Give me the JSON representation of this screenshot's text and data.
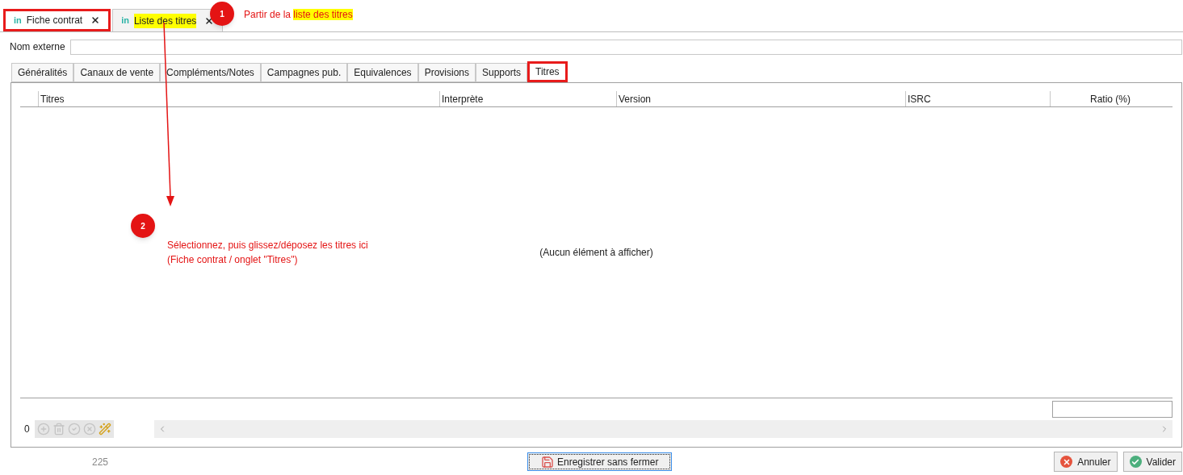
{
  "doc_tabs": [
    {
      "logo": "in",
      "label": "Fiche contrat",
      "selected": true,
      "outlined": true,
      "highlighted": false
    },
    {
      "logo": "in",
      "label": "Liste des titres",
      "selected": false,
      "outlined": false,
      "highlighted": true
    }
  ],
  "external_name": {
    "label": "Nom externe"
  },
  "tabs": [
    {
      "label": "Généralités",
      "selected": false,
      "outlined": false
    },
    {
      "label": "Canaux de vente",
      "selected": false,
      "outlined": false
    },
    {
      "label": "Compléments/Notes",
      "selected": false,
      "outlined": false
    },
    {
      "label": "Campagnes pub.",
      "selected": false,
      "outlined": false
    },
    {
      "label": "Equivalences",
      "selected": false,
      "outlined": false
    },
    {
      "label": "Provisions",
      "selected": false,
      "outlined": false
    },
    {
      "label": "Supports",
      "selected": false,
      "outlined": false
    },
    {
      "label": "Titres",
      "selected": true,
      "outlined": true
    }
  ],
  "grid": {
    "columns": [
      "Titres",
      "Interprète",
      "Version",
      "ISRC",
      "Ratio (%)"
    ],
    "empty_text": "(Aucun élément à afficher)",
    "row_count": "0",
    "toolbar": [
      {
        "kind": "add",
        "disabled": true
      },
      {
        "kind": "delete",
        "disabled": true
      },
      {
        "kind": "confirm",
        "disabled": true
      },
      {
        "kind": "cancel",
        "disabled": true
      },
      {
        "kind": "wand",
        "disabled": false
      }
    ]
  },
  "footer": {
    "counter": "225",
    "save_button": {
      "label": "Enregistrer sans fermer",
      "focused": true
    },
    "buttons": [
      {
        "kind": "cancel",
        "label": "Annuler"
      },
      {
        "kind": "ok",
        "label": "Valider"
      }
    ]
  },
  "annotations": [
    {
      "number": "1",
      "parts": [
        {
          "text": "Partir de la ",
          "highlighted": false
        },
        {
          "text": "liste des titres",
          "highlighted": true
        }
      ]
    },
    {
      "number": "2",
      "parts": [
        {
          "text": "Sélectionnez, puis glissez/déposez les titres ici (Fiche contrat / onglet \"Titres\")",
          "highlighted": false
        }
      ]
    }
  ]
}
